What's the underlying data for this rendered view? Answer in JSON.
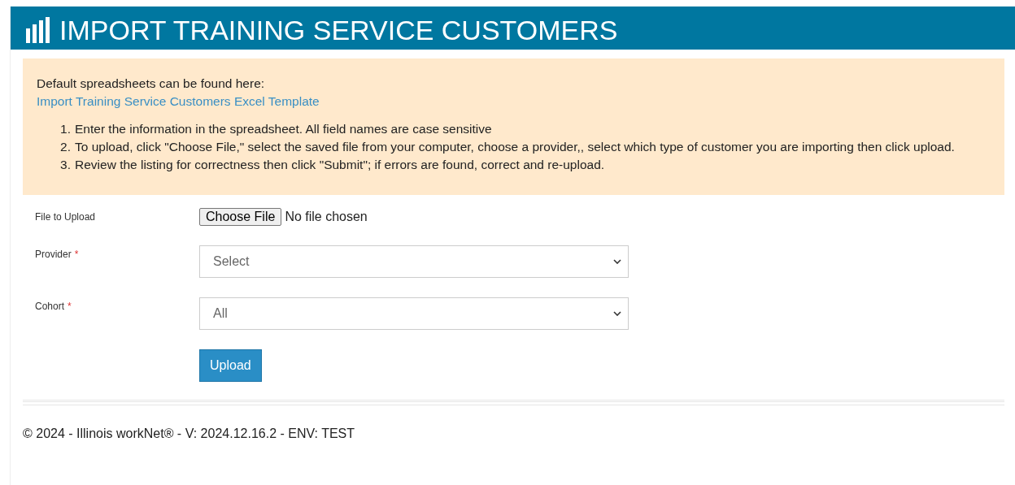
{
  "header": {
    "title": "IMPORT TRAINING SERVICE CUSTOMERS"
  },
  "info": {
    "intro": "Default spreadsheets can be found here:",
    "link": "Import Training Service Customers Excel Template",
    "steps": [
      {
        "marker": "1.",
        "text": "Enter the information in the spreadsheet. All field names are case sensitive"
      },
      {
        "marker": "2.",
        "text": "To upload, click \"Choose File,\" select the saved file from your computer, choose a provider,, select which type of customer you are importing then click upload."
      },
      {
        "marker": "3.",
        "text": "Review the listing for correctness then click \"Submit\"; if errors are found, correct and re-upload."
      }
    ]
  },
  "form": [
    {
      "kind": "file",
      "label": "File to Upload",
      "button": "Choose File",
      "status": "No file chosen"
    },
    {
      "kind": "select",
      "label": "Provider",
      "required_mark": "*",
      "value": "Select"
    },
    {
      "kind": "select",
      "label": "Cohort",
      "required_mark": "*",
      "value": "All"
    },
    {
      "kind": "button",
      "label": "Upload"
    }
  ],
  "footer": "© 2024 - Illinois workNet® - V: 2024.12.16.2 - ENV: TEST"
}
